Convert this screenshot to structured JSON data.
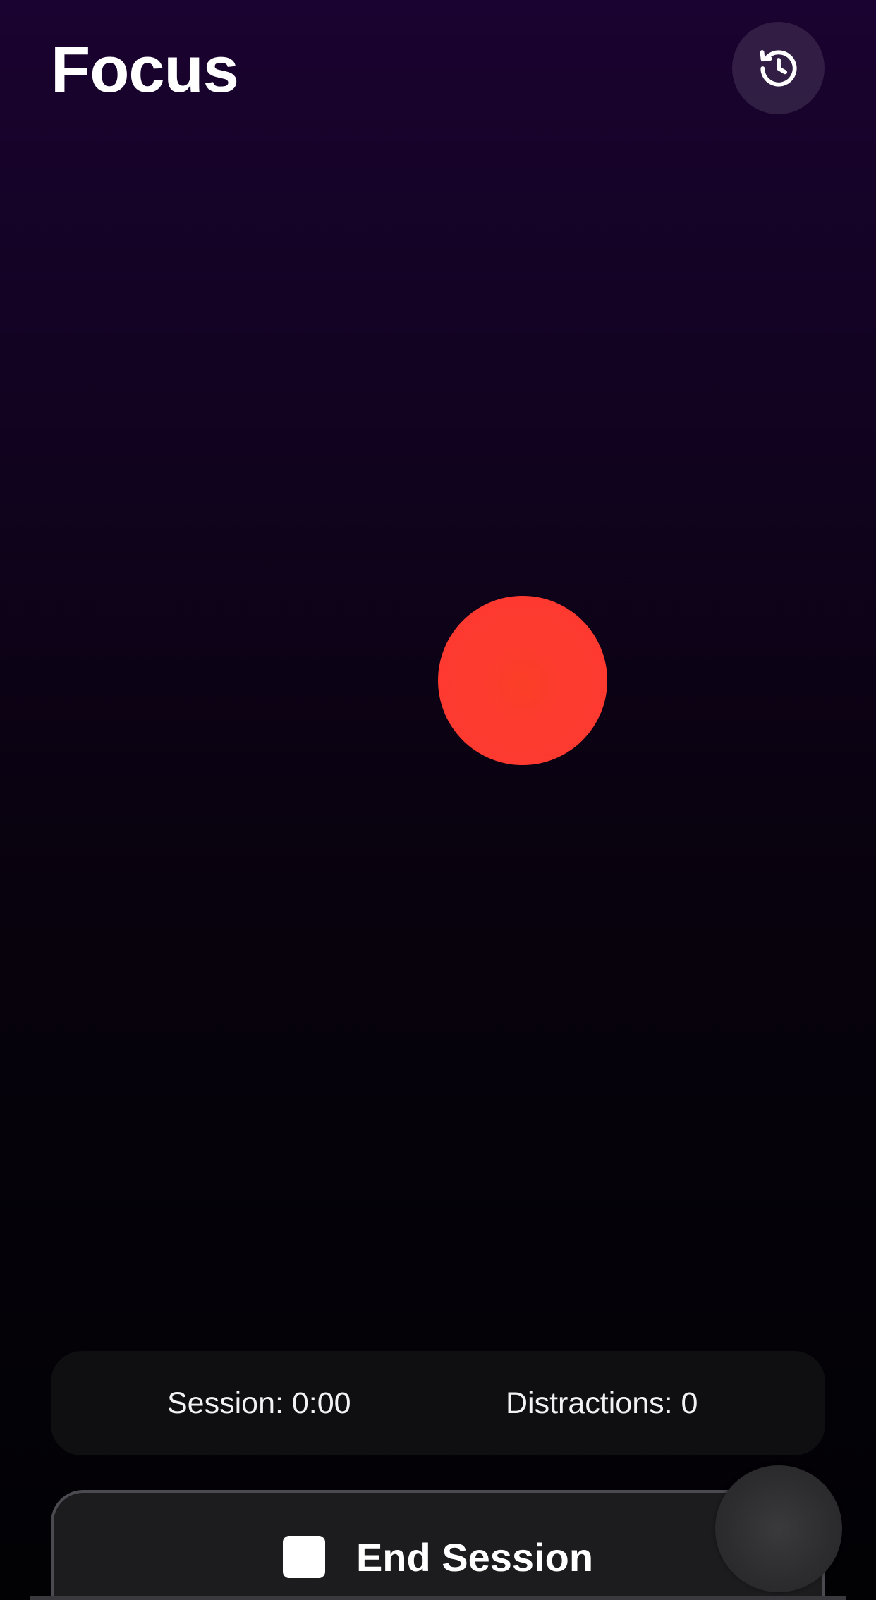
{
  "header": {
    "title": "Focus",
    "history_icon": "history-clock-icon"
  },
  "focus_indicator": {
    "color": "#fe3a30",
    "shape": "circle"
  },
  "stats": {
    "session": "Session: 0:00",
    "distractions": "Distractions: 0"
  },
  "actions": {
    "end_session_label": "End Session",
    "end_session_icon": "stop-icon"
  },
  "colors": {
    "background_top": "#1a0330",
    "background_bottom": "#020104",
    "accent": "#fe3a30",
    "panel": "#0f0f12",
    "button": "#1c1c1f"
  }
}
